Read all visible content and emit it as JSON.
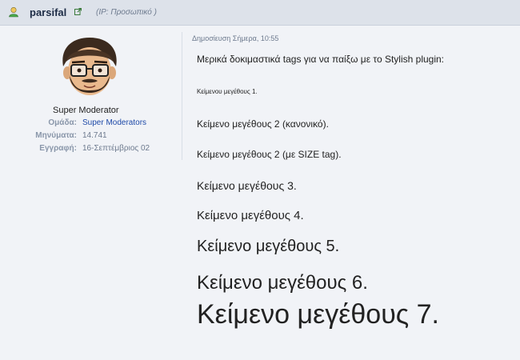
{
  "header": {
    "username": "parsifal",
    "ip_text": "(IP: Προσωπικό )",
    "user_icon": "user-icon",
    "external_icon": "external-link-icon"
  },
  "profile": {
    "avatar": "avatar-cartoon-bearded-man-glasses",
    "role": "Super Moderator",
    "fields": [
      {
        "label": "Ομάδα:",
        "value": "Super Moderators"
      },
      {
        "label": "Μηνύματα:",
        "value": "14.741"
      },
      {
        "label": "Εγγραφή:",
        "value": "16-Σεπτέμβριος 02"
      }
    ]
  },
  "post": {
    "posted_at": "Δημοσίευση Σήμερα, 10:55",
    "lines": [
      "Μερικά δοκιμαστικά tags για να παίξω με το Stylish plugin:",
      "Κείμενου μεγέθους 1.",
      "Κείμενο μεγέθους 2 (κανονικό).",
      "Κείμενο μεγέθους 2 (με SIZE tag).",
      "Κείμενο μεγέθους 3.",
      "Κείμενο μεγέθους 4.",
      "Κείμενο μεγέθους 5.",
      "Κείμενο μεγέθους 6.",
      "Κείμενο μεγέθους 7."
    ]
  },
  "colors": {
    "background": "#f1f3f7",
    "header_bar": "#dde2ea",
    "link_blue": "#1f4aa8",
    "label_gray": "#8a97aa"
  }
}
